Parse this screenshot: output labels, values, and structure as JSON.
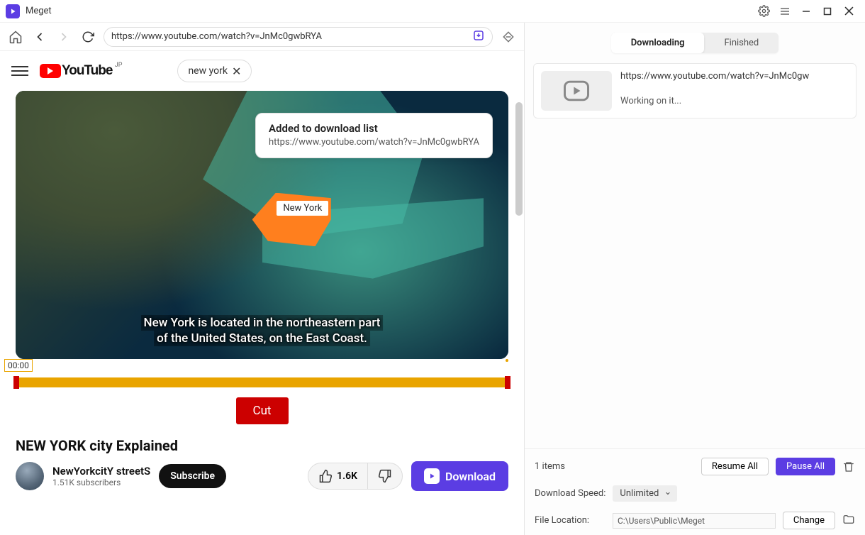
{
  "app": {
    "name": "Meget"
  },
  "nav": {
    "url": "https://www.youtube.com/watch?v=JnMc0gwbRYA"
  },
  "yt": {
    "brand": "YouTube",
    "region": "JP",
    "search_chip": "new york",
    "map_label": "New York",
    "caption_line1": "New York is located in the northeastern part",
    "caption_line2": "of the United States, on the East Coast.",
    "time": "00:00",
    "cut": "Cut",
    "title": "NEW YORK city Explained",
    "channel": "NewYorkcitY streetS",
    "subs": "1.51K subscribers",
    "subscribe": "Subscribe",
    "likes": "1.6K",
    "download": "Download"
  },
  "toast": {
    "title": "Added to download list",
    "url": "https://www.youtube.com/watch?v=JnMc0gwbRYA"
  },
  "right": {
    "tab_downloading": "Downloading",
    "tab_finished": "Finished",
    "item_url": "https://www.youtube.com/watch?v=JnMc0gw",
    "item_status": "Working on it...",
    "items_count": "1 items",
    "resume": "Resume All",
    "pause": "Pause All",
    "speed_label": "Download Speed:",
    "speed_value": "Unlimited",
    "loc_label": "File Location:",
    "loc_value": "C:\\Users\\Public\\Meget",
    "change": "Change"
  }
}
